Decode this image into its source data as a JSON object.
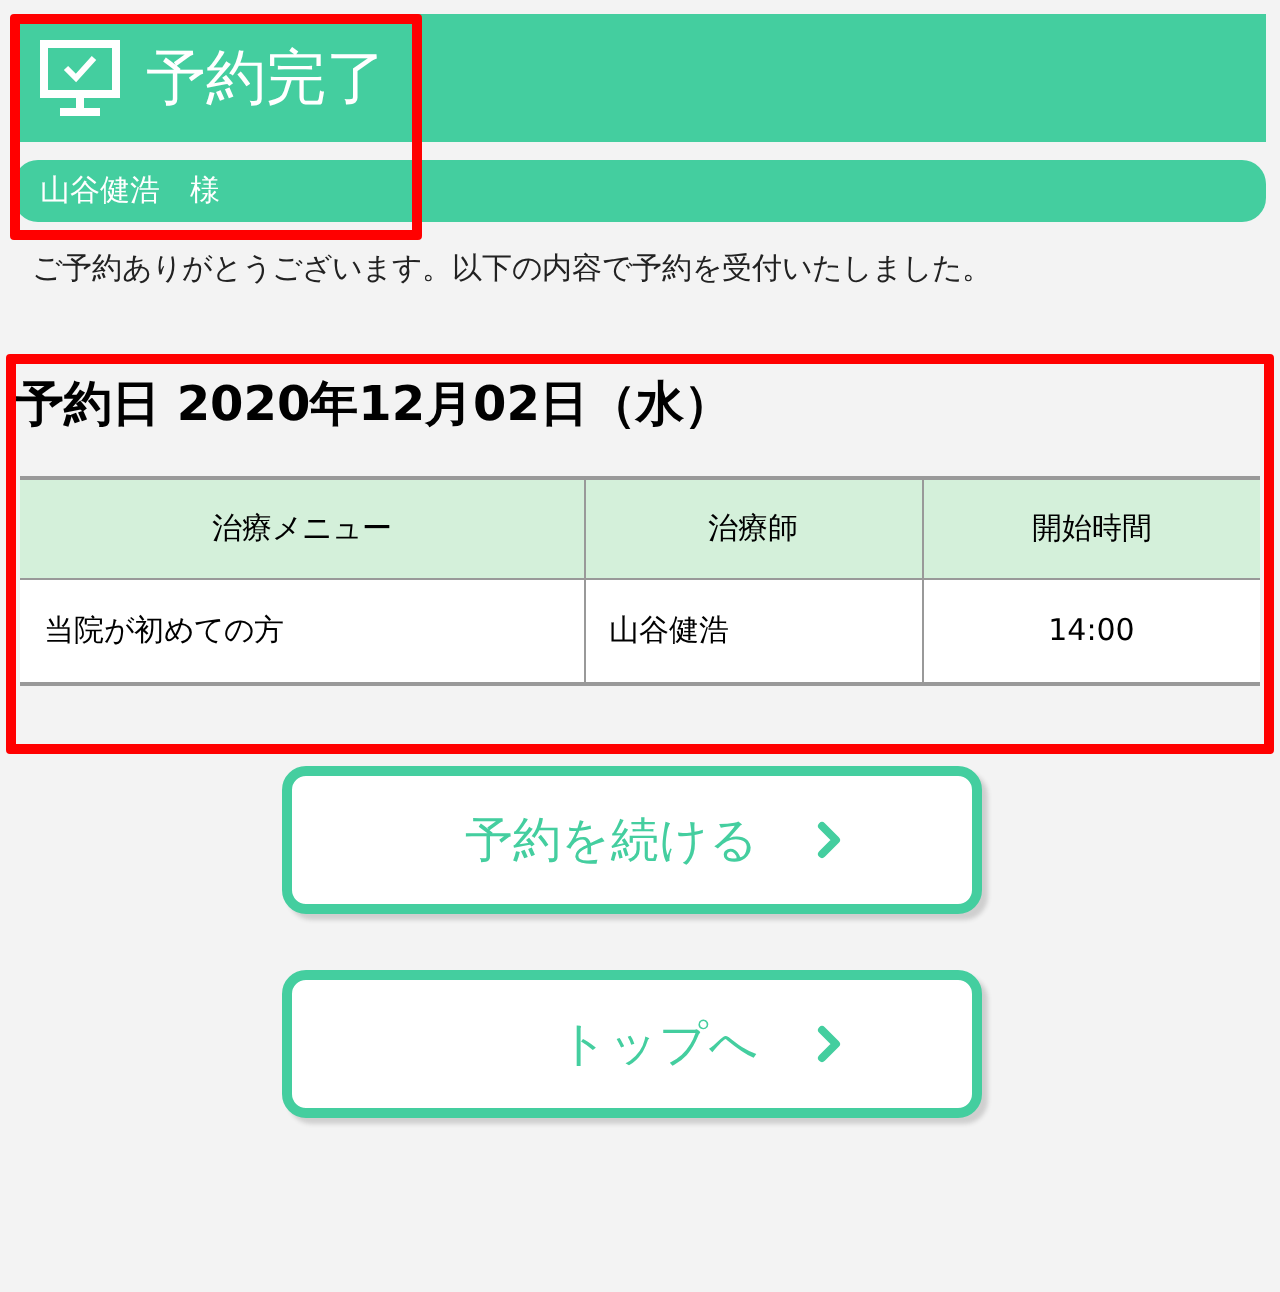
{
  "header": {
    "title": "予約完了"
  },
  "customer": {
    "name": "山谷健浩　様"
  },
  "message": "ご予約ありがとうございます。以下の内容で予約を受付いたしました。",
  "reservation_date": "予約日 2020年12月02日（水）",
  "table": {
    "columns": [
      "治療メニュー",
      "治療師",
      "開始時間"
    ],
    "rows": [
      [
        "当院が初めての方",
        "山谷健浩",
        "14:00"
      ]
    ]
  },
  "buttons": [
    {
      "label": "予約を続ける"
    },
    {
      "label": "トップへ"
    }
  ]
}
